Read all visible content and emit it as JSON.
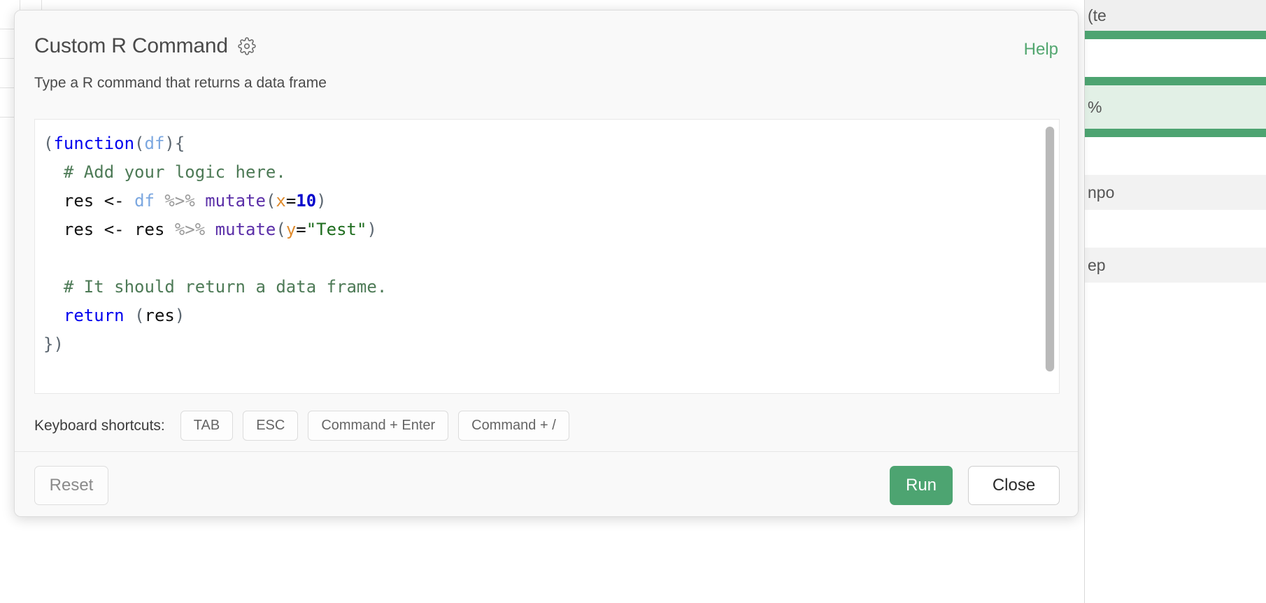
{
  "dialog": {
    "title": "Custom R Command",
    "gear_icon": "gear-icon",
    "help_label": "Help",
    "subtitle": "Type a R command that returns a data frame",
    "accent_color": "#4da471",
    "help_color": "#52a66f"
  },
  "editor": {
    "language": "R",
    "lines": [
      "(function(df){",
      "  # Add your logic here.",
      "  res <- df %>% mutate(x=10)",
      "  res <- res %>% mutate(y=\"Test\")",
      "",
      "  # It should return a data frame.",
      "  return (res)",
      "})"
    ],
    "code": "(function(df){\n  # Add your logic here.\n  res <- df %>% mutate(x=10)\n  res <- res %>% mutate(y=\"Test\")\n\n  # It should return a data frame.\n  return (res)\n})"
  },
  "shortcuts": {
    "label": "Keyboard shortcuts:",
    "keys": [
      "TAB",
      "ESC",
      "Command + Enter",
      "Command + /"
    ]
  },
  "footer": {
    "reset_label": "Reset",
    "run_label": "Run",
    "close_label": "Close"
  },
  "background": {
    "cells": [
      {
        "text": "(te",
        "type": "head"
      },
      {
        "text": "",
        "type": "sep"
      },
      {
        "text": "",
        "type": "blank"
      },
      {
        "text": "%",
        "type": "green"
      },
      {
        "text": "",
        "type": "sep"
      },
      {
        "text": "",
        "type": "blank"
      },
      {
        "text": "npo",
        "type": "cell"
      },
      {
        "text": "",
        "type": "blank"
      },
      {
        "text": "ep",
        "type": "cell"
      }
    ]
  }
}
